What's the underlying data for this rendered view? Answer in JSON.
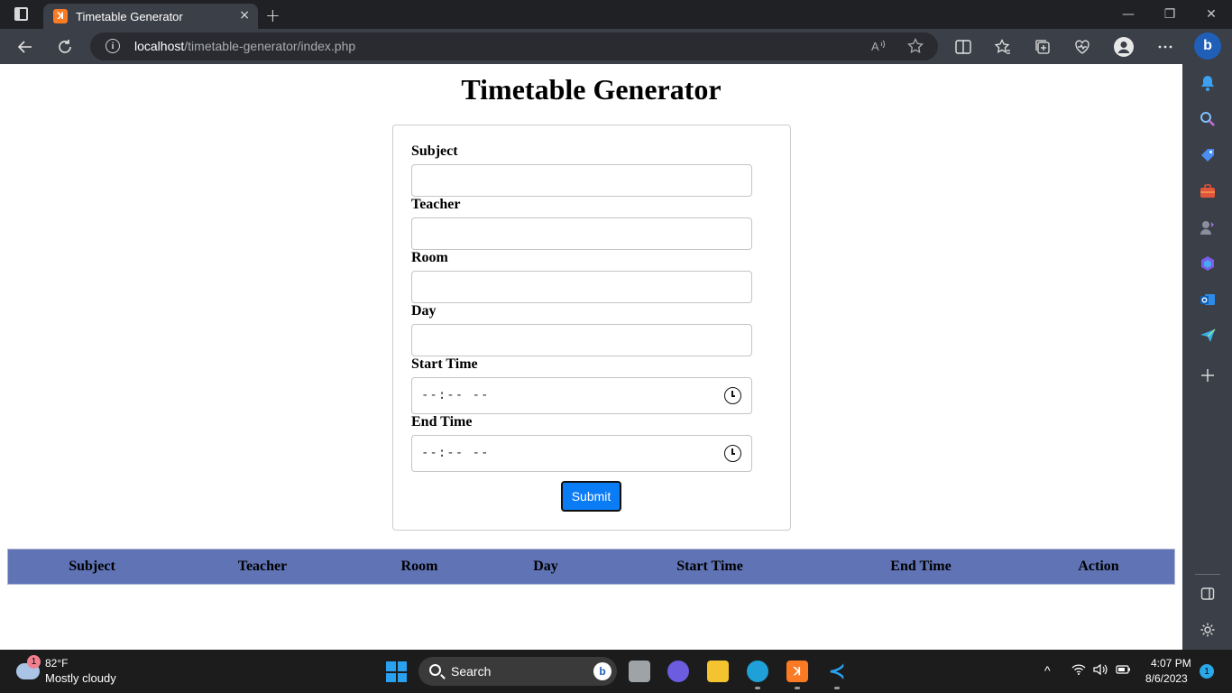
{
  "browser": {
    "tab_title": "Timetable Generator",
    "tab_close_glyph": "×",
    "new_tab_glyph": "+",
    "url_host": "localhost",
    "url_path": "/timetable-generator/index.php",
    "window_controls": {
      "minimize": "—",
      "restore": "❐",
      "close": "✕"
    }
  },
  "page": {
    "title": "Timetable Generator",
    "form": {
      "subject_label": "Subject",
      "teacher_label": "Teacher",
      "room_label": "Room",
      "day_label": "Day",
      "start_time_label": "Start Time",
      "start_time_placeholder": "--:-- --",
      "end_time_label": "End Time",
      "end_time_placeholder": "--:-- --",
      "submit_label": "Submit"
    },
    "table": {
      "headers": [
        "Subject",
        "Teacher",
        "Room",
        "Day",
        "Start Time",
        "End Time",
        "Action"
      ],
      "rows": []
    },
    "colors": {
      "table_header_bg": "#5f73b5",
      "submit_bg": "#0a7cf5"
    }
  },
  "taskbar": {
    "weather_temp": "82°F",
    "weather_desc": "Mostly cloudy",
    "weather_badge": "1",
    "search_label": "Search",
    "time": "4:07 PM",
    "date": "8/6/2023",
    "notification_count": "1"
  }
}
